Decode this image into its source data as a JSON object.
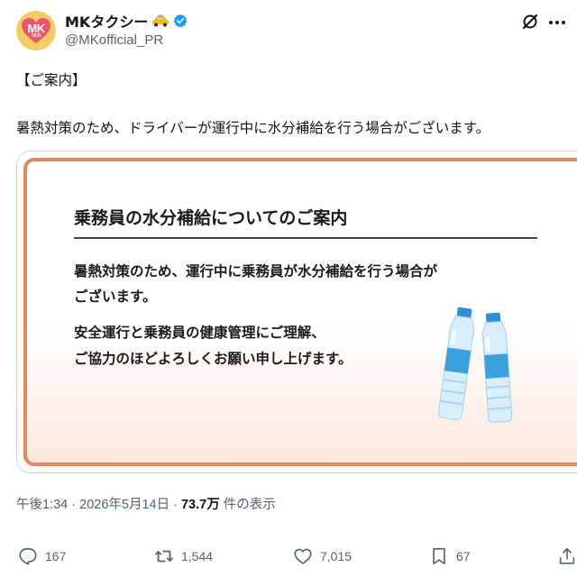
{
  "author": {
    "display_name": "MKタクシー",
    "handle": "@MKofficial_PR",
    "avatar_text": "MK",
    "avatar_subtext": "TAXI"
  },
  "post": {
    "line1": "【ご案内】",
    "line2": "暑熱対策のため、ドライバーが運行中に水分補給を行う場合がございます。"
  },
  "notice_image": {
    "title": "乗務員の水分補給についてのご案内",
    "p1_line1": "暑熱対策のため、運行中に乗務員が水分補給を行う場合が",
    "p1_line2": "ございます。",
    "p2_line1": "安全運行と乗務員の健康管理にご理解、",
    "p2_line2": "ご協力のほどよろしくお願い申し上げます。"
  },
  "meta": {
    "time": "午後1:34",
    "sep1": " · ",
    "date": "2026年5月14日",
    "sep2": " · ",
    "views": "73.7万",
    "views_label": " 件の表示"
  },
  "actions": {
    "replies": "167",
    "reposts": "1,544",
    "likes": "7,015",
    "bookmarks": "67"
  },
  "icons": [
    "taxi-icon",
    "verified-icon",
    "grok-icon",
    "more-icon",
    "reply-icon",
    "retweet-icon",
    "like-icon",
    "bookmark-icon",
    "share-icon",
    "water-bottle-icon"
  ],
  "colors": {
    "verified": "#1d9bf0",
    "notice_border": "#e08a63",
    "bottle": "#3aa0de",
    "avatar_bg": "#f4cc63",
    "avatar_heart": "#e8576f"
  }
}
